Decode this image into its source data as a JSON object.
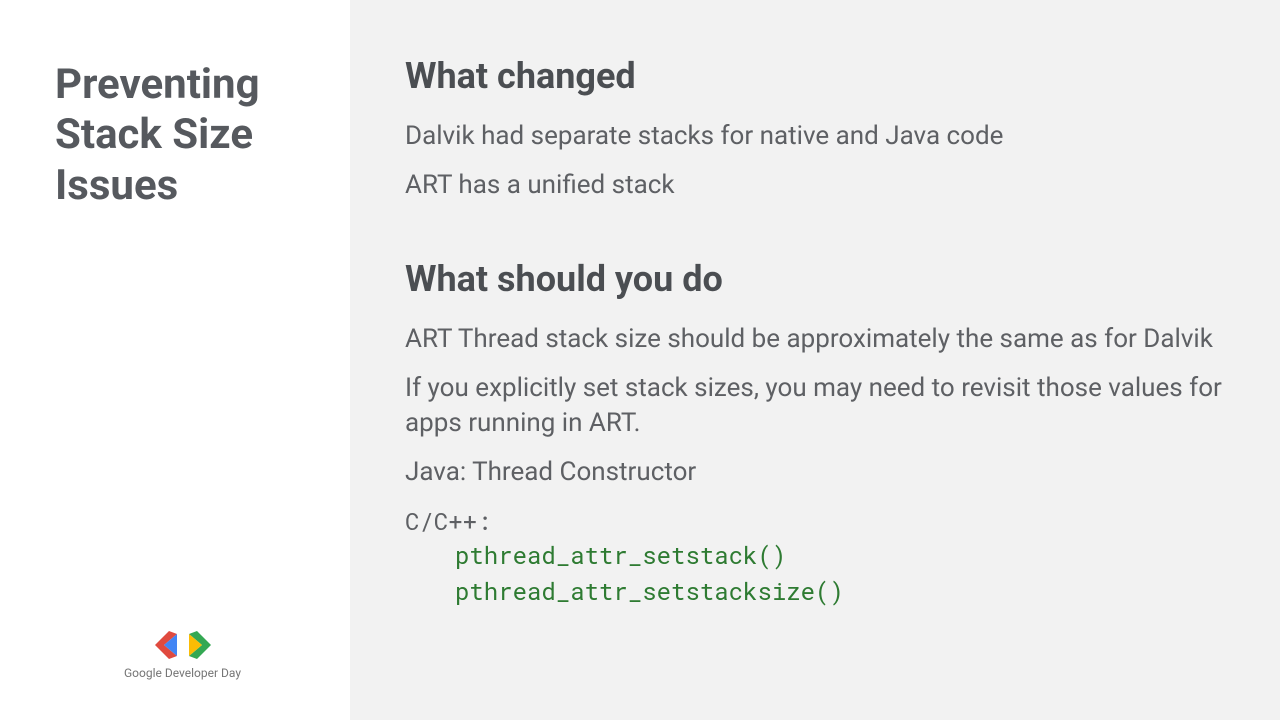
{
  "sidebar": {
    "title": "Preventing Stack Size Issues",
    "footer_text": "Google Developer Day"
  },
  "main": {
    "section1": {
      "heading": "What changed",
      "line1": "Dalvik had separate stacks for native and Java code",
      "line2": "ART has a unified stack"
    },
    "section2": {
      "heading": "What should you do",
      "line1": "ART Thread stack size should be approximately the same as for Dalvik",
      "line2": "If you explicitly set stack sizes, you may need to revisit those values for apps running in ART.",
      "line3": "Java: Thread Constructor",
      "code_label": "C/C++:",
      "code1": "pthread_attr_setstack()",
      "code2": "pthread_attr_setstacksize()"
    }
  }
}
